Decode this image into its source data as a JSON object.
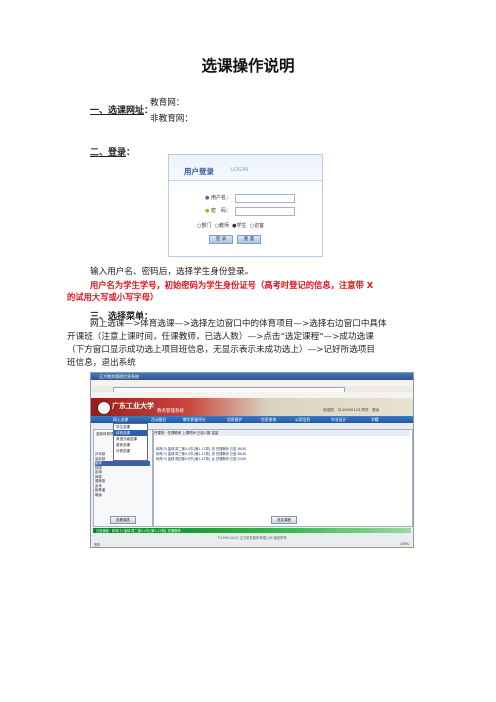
{
  "doc": {
    "title": "选课操作说明",
    "section1": {
      "heading": "一、选课网址",
      "colon": "：",
      "edu_label": "教育网：",
      "nonedu_label": "非教育网："
    },
    "section2": {
      "heading": "二、登录",
      "colon": "："
    },
    "login_box": {
      "title": "用户登录",
      "title_en": "LOGIN",
      "user_label": "用户名：",
      "pass_label": "密　码：",
      "roles": [
        "部门",
        "教师",
        "学生",
        "访客"
      ],
      "btn_login": "登 录",
      "btn_reset": "重 置"
    },
    "para_login": "输入用户名、密码后，选择学生身份登录。",
    "red_note_1": "用户名为学生学号，初始密码为学生身份证号（高考时登记的信息，注意带 X",
    "red_note_2": "的试用大写或小写字母）",
    "section3": {
      "heading": "三、选择菜单",
      "colon": "："
    },
    "para_menu_1": "网上选课—>体育选课—>选择左边窗口中的体育项目—>选择右边窗口中具体",
    "para_menu_2": "开课班（注意上课时间，任课教师，已选人数）—>点击“选定课程”—>成功选课",
    "para_menu_3": "（下方窗口显示成功选上项目班信息，无显示表示未成功选上）—>记好所选项目",
    "para_menu_4": "班信息，退出系统"
  },
  "screenshot": {
    "window_title": "正方教务管理信息系统",
    "address": "http://jwgl.gdut.edu.cn/(xxxxxxxx)/xs_main.aspx?xh=3110000123",
    "banner": "广东工业大学",
    "banner_sub": "教务管理系统",
    "user_info": "欢迎您：3110000123 同学　退出",
    "nav": [
      "网上选课",
      "活动报名",
      "教学质量评价",
      "信息维护",
      "信息查询",
      "公用信息",
      "毕业设计",
      "学籍"
    ],
    "dropdown": [
      "学生选课",
      "体育选课",
      "英语分级选课",
      "重修选课",
      "补修选课"
    ],
    "dropdown_selected": 1,
    "left_head": "选择体育项目",
    "sports": [
      "乒乓球",
      "羽毛球",
      "篮球",
      "排球",
      "足球",
      "网球",
      "健美操",
      "武术",
      "跆拳道",
      "瑜伽"
    ],
    "sports_selected": 2,
    "right_head": "开课班：任课教师 上课时间 已选人数 容量",
    "class_rows": [
      "体育(3) 篮球 周二第3,4节{第1-17周} 男 任课教师 已选 36/40",
      "体育(3) 篮球 周三第3,4节{第1-17周} 男 任课教师 已选 38/40",
      "体育(3) 篮球 周四第5,6节{第1-17周} 女 任课教师 已选 22/40"
    ],
    "btn_select": "选定课程",
    "btn_view": "查看课表",
    "selected_bar": "已选课程：体育(3) 篮球 周二第3,4节{第1-17周} 任课教师",
    "footer": "©1999-2010 正方软件股份有限公司 版权所有",
    "status": "完毕",
    "zoom": "100%"
  }
}
